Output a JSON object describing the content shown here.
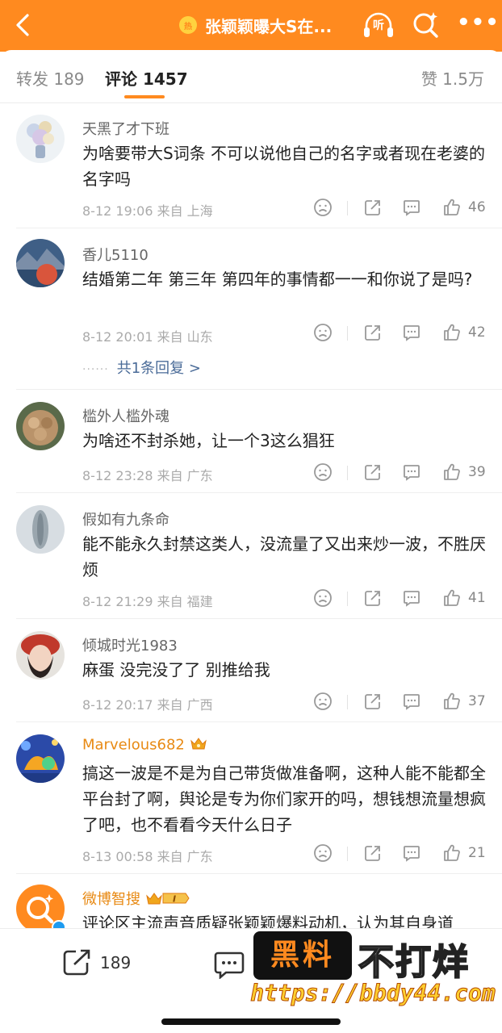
{
  "header": {
    "hot_badge": "热",
    "title": "张颖颖曝大S在...",
    "listen_label": "听",
    "more_label": "•••"
  },
  "tabs": {
    "repost": "转发 189",
    "comments": "评论 1457",
    "likes": "赞 1.5万"
  },
  "comments": [
    {
      "name": "天黑了才下班",
      "text": "为啥要带大S词条 不可以说他自己的名字或者现在老婆的名字吗",
      "meta": "8-12 19:06 来自 上海",
      "likes": "46"
    },
    {
      "name": "香儿5110",
      "text": "结婚第二年 第三年 第四年的事情都一一和你说了是吗?",
      "meta": "8-12 20:01 来自 山东",
      "likes": "42",
      "replies": "共1条回复 >"
    },
    {
      "name": "槛外人槛外魂",
      "text": "为啥还不封杀她，让一个3这么猖狂",
      "meta": "8-12 23:28 来自 广东",
      "likes": "39"
    },
    {
      "name": "假如有九条命",
      "text": "能不能永久封禁这类人，没流量了又出来炒一波，不胜厌烦",
      "meta": "8-12 21:29 来自 福建",
      "likes": "41"
    },
    {
      "name": "倾城时光1983",
      "text": "麻蛋 没完没了了 别推给我",
      "meta": "8-12 20:17 来自 广西",
      "likes": "37"
    },
    {
      "name": "Marvelous682",
      "text": "搞这一波是不是为自己带货做准备啊，这种人能不能都全平台封了啊，舆论是专为你们家开的吗，想钱想流量想疯了吧，也不看看今天什么日子",
      "meta": "8-13 00:58 来自 广东",
      "likes": "21"
    },
    {
      "name": "微博智搜",
      "text": "评论区主流声音质疑张颖颖爆料动机，认为其自身道",
      "level_badge": "I"
    }
  ],
  "bottom": {
    "share_count": "189"
  },
  "watermark": {
    "left_text": "黑料",
    "right_text": "不打烊",
    "url": "https://bbdy44.com"
  },
  "colors": {
    "brand_orange": "#ff8a1f",
    "link_blue": "#4a6b98",
    "vip_gold": "#e88a14"
  }
}
